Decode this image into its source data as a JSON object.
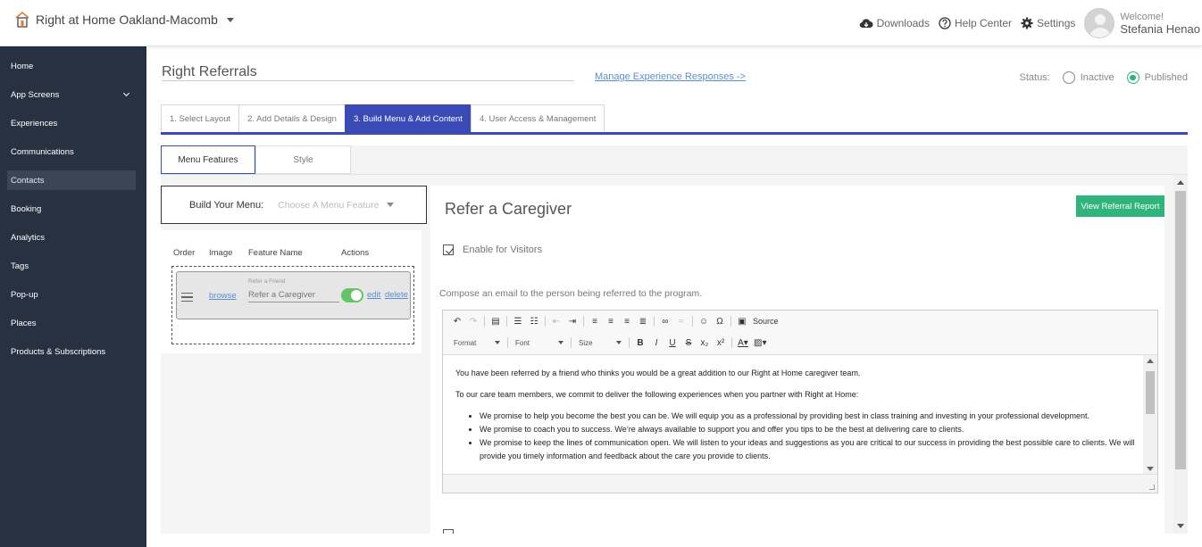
{
  "header": {
    "org_name": "Right at Home Oakland-Macomb",
    "downloads": "Downloads",
    "help_center": "Help Center",
    "settings": "Settings",
    "welcome": "Welcome!",
    "user_name": "Stefania Henao"
  },
  "sidebar": {
    "items": [
      {
        "label": "Home"
      },
      {
        "label": "App Screens"
      },
      {
        "label": "Experiences"
      },
      {
        "label": "Communications"
      },
      {
        "label": "Contacts"
      },
      {
        "label": "Booking"
      },
      {
        "label": "Analytics"
      },
      {
        "label": "Tags"
      },
      {
        "label": "Pop-up"
      },
      {
        "label": "Places"
      },
      {
        "label": "Products & Subscriptions"
      }
    ],
    "active": "Contacts"
  },
  "page": {
    "title": "Right Referrals",
    "manage_link": "Manage Experience Responses ->",
    "status_label": "Status:",
    "status_inactive": "Inactive",
    "status_published": "Published",
    "status_value": "Published"
  },
  "steps": [
    {
      "label": "1. Select Layout"
    },
    {
      "label": "2. Add Details & Design"
    },
    {
      "label": "3. Build Menu & Add Content"
    },
    {
      "label": "4. User Access & Management"
    }
  ],
  "subtabs": {
    "menu_features": "Menu Features",
    "style": "Style"
  },
  "builder": {
    "label": "Build Your Menu:",
    "select_placeholder": "Choose A Menu Feature",
    "headers": {
      "order": "Order",
      "image": "Image",
      "feature_name": "Feature Name",
      "actions": "Actions"
    },
    "row": {
      "browse": "browse",
      "small_label": "Refer a Friend",
      "feature_name": "Refer a Caregiver",
      "edit": "edit",
      "delete": "delete",
      "enabled": true
    }
  },
  "detail": {
    "title": "Refer a Caregiver",
    "report_button": "View Referral Report",
    "enable_label": "Enable for Visitors",
    "enable_checked": true,
    "compose_label": "Compose an email to the person being referred to the program."
  },
  "editor": {
    "source_label": "Source",
    "format": "Format",
    "font": "Font",
    "size": "Size",
    "paragraph1": "You have been referred by a friend who thinks you would be a great addition to our Right at Home caregiver team.",
    "paragraph2": "To our care team members, we commit to deliver the following experiences when you partner with Right at Home:",
    "bullets": [
      "We promise to help you become the best you can be. We will equip you as a professional by providing best in class training and investing in your professional development.",
      "We promise to coach you to success. We’re always available to support you and offer you tips to be the best at delivering care to clients.",
      "We promise to keep the lines of communication open. We will listen to your ideas and suggestions as you are critical to our success in providing the best possible care to clients. We will provide you timely information and feedback about the care you provide to clients."
    ]
  },
  "colors": {
    "sidebar_bg": "#273142",
    "accent": "#3a4bb8",
    "success": "#2fb47c",
    "link": "#5b8fd1"
  }
}
